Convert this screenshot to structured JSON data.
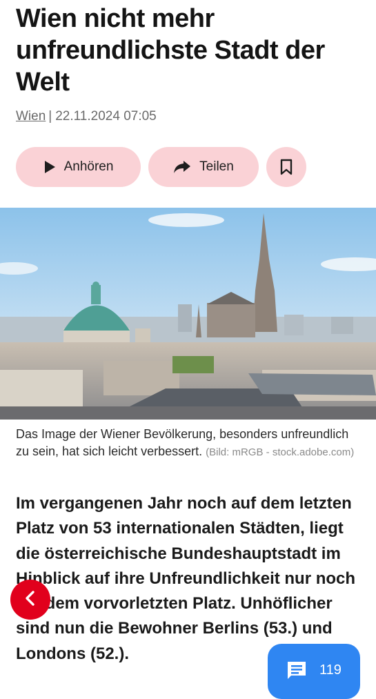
{
  "article": {
    "headline": "Wien nicht mehr unfreundlichste Stadt der Welt",
    "category": "Wien",
    "separator": "|",
    "date": "22.11.2024 07:05",
    "image_caption": "Das Image der Wiener Bevölkerung, besonders unfreundlich zu sein, hat sich leicht verbessert.",
    "image_credit": "(Bild: mRGB - stock.adobe.com)",
    "lead": "Im vergangenen Jahr noch auf dem letzten Platz von 53 internationalen Städten, liegt die österreichische Bundeshauptstadt im Hinblick auf ihre Unfreundlichkeit nur noch auf dem vorvorletzten Platz. Unhöflicher sind nun die Bewohner Berlins (53.) und Londons (52.)."
  },
  "actions": {
    "listen_label": "Anhören",
    "share_label": "Teilen",
    "listen_icon": "play-icon",
    "share_icon": "share-arrow-icon",
    "save_icon": "bookmark-icon"
  },
  "fab": {
    "back_icon": "chevron-left-icon",
    "comment_icon": "comment-icon",
    "comment_count": "119"
  },
  "colors": {
    "pill_bg": "#fad2d6",
    "back_fab": "#e1001c",
    "comment_fab": "#2f86f2"
  }
}
